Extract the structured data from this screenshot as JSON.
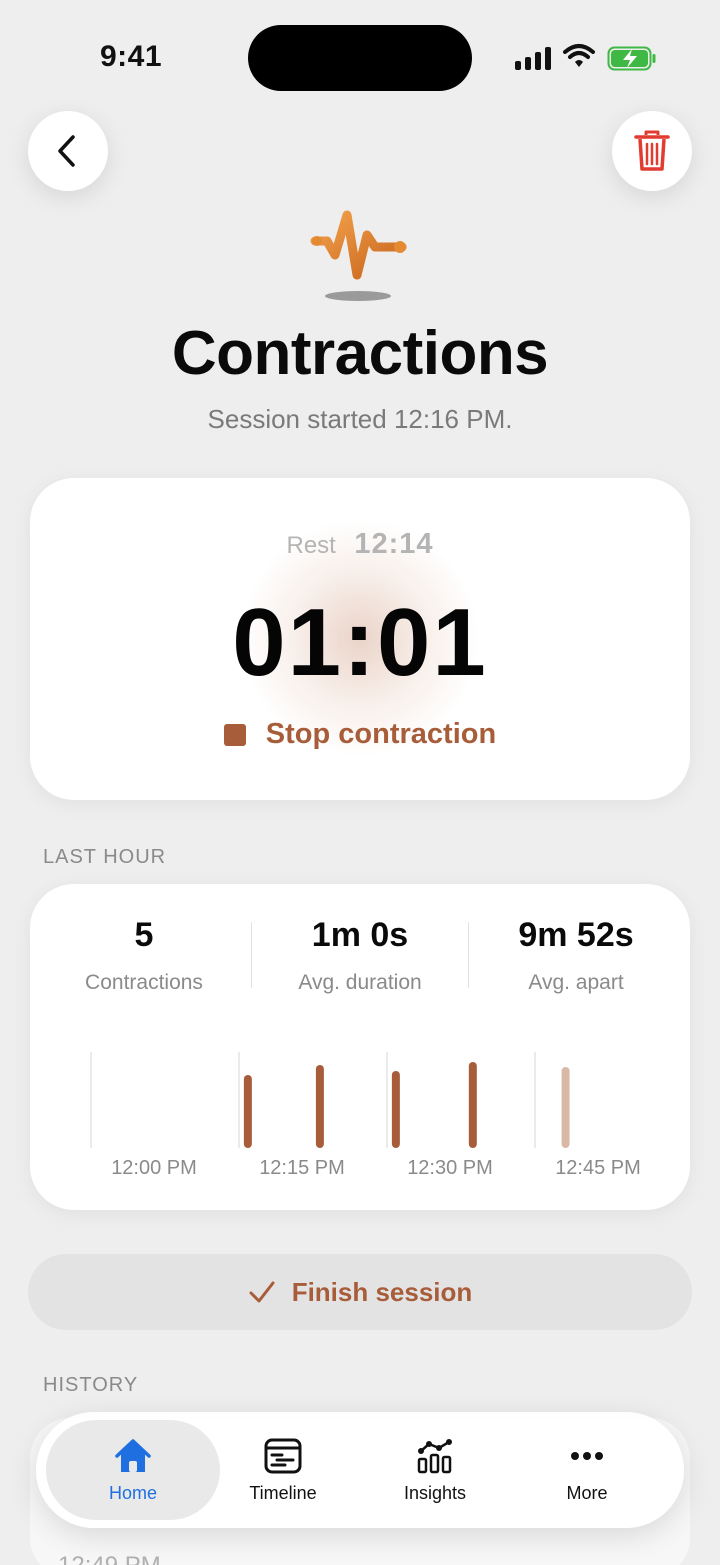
{
  "status_bar": {
    "time": "9:41"
  },
  "header": {
    "title": "Contractions",
    "subtitle": "Session started 12:16 PM."
  },
  "timer": {
    "rest_label": "Rest",
    "rest_time": "12:14",
    "elapsed": "01:01",
    "stop_label": "Stop contraction"
  },
  "last_hour": {
    "section_label": "LAST HOUR",
    "stats": [
      {
        "value": "5",
        "label": "Contractions"
      },
      {
        "value": "1m 0s",
        "label": "Avg. duration"
      },
      {
        "value": "9m 52s",
        "label": "Avg. apart"
      }
    ]
  },
  "chart_data": {
    "type": "bar",
    "x_tick_labels": [
      "12:00 PM",
      "12:15 PM",
      "12:30 PM",
      "12:45 PM"
    ],
    "x_range": [
      0,
      60
    ],
    "bars": [
      {
        "t": 16.0,
        "height": 0.73,
        "in_progress": false
      },
      {
        "t": 23.3,
        "height": 0.83,
        "in_progress": false
      },
      {
        "t": 31.0,
        "height": 0.77,
        "in_progress": false
      },
      {
        "t": 38.8,
        "height": 0.86,
        "in_progress": false
      },
      {
        "t": 48.2,
        "height": 0.81,
        "in_progress": true
      }
    ],
    "colors": {
      "bar": "#a85d3a",
      "bar_in_progress": "#d9b8a6",
      "grid": "#e4e4e4"
    }
  },
  "finish": {
    "label": "Finish session"
  },
  "history": {
    "section_label": "HISTORY",
    "peek_text": "12:49 PM"
  },
  "tabs": [
    {
      "label": "Home",
      "icon": "house-icon",
      "active": true
    },
    {
      "label": "Timeline",
      "icon": "timeline-icon",
      "active": false
    },
    {
      "label": "Insights",
      "icon": "insights-icon",
      "active": false
    },
    {
      "label": "More",
      "icon": "more-icon",
      "active": false
    }
  ],
  "colors": {
    "accent": "#a85d3a",
    "active_tab": "#1f6fe0",
    "delete": "#e23b30"
  }
}
